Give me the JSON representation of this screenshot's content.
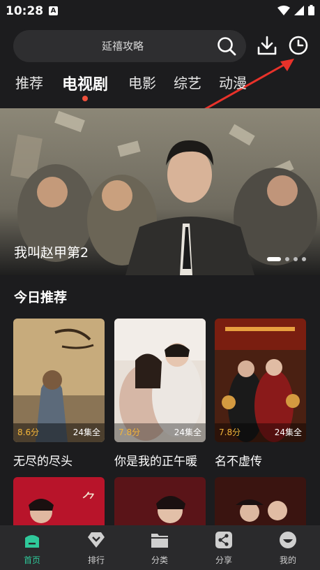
{
  "status_bar": {
    "time": "10:28",
    "a_icon": "A"
  },
  "search": {
    "placeholder_text": "延禧攻略"
  },
  "tabs": [
    {
      "label": "推荐"
    },
    {
      "label": "电视剧"
    },
    {
      "label": "电影"
    },
    {
      "label": "综艺"
    },
    {
      "label": "动漫"
    }
  ],
  "active_tab": "电视剧",
  "banner": {
    "caption": "我叫赵甲第2",
    "slide_count": 4,
    "active_slide": 1
  },
  "today": {
    "title": "今日推荐",
    "items": [
      {
        "title": "无尽的尽头",
        "score": "8.6分",
        "episodes": "24集全"
      },
      {
        "title": "你是我的正午暖",
        "score": "7.8分",
        "episodes": "24集全"
      },
      {
        "title": "名不虚传",
        "score": "7.8分",
        "episodes": "24集全"
      }
    ]
  },
  "bottom_nav": [
    {
      "label": "首页"
    },
    {
      "label": "排行"
    },
    {
      "label": "分类"
    },
    {
      "label": "分享"
    },
    {
      "label": "我的"
    }
  ],
  "colors": {
    "accent": "#2fc89a",
    "score": "#f4b63a",
    "dot": "#f0503c",
    "background": "#1c1c1e"
  }
}
